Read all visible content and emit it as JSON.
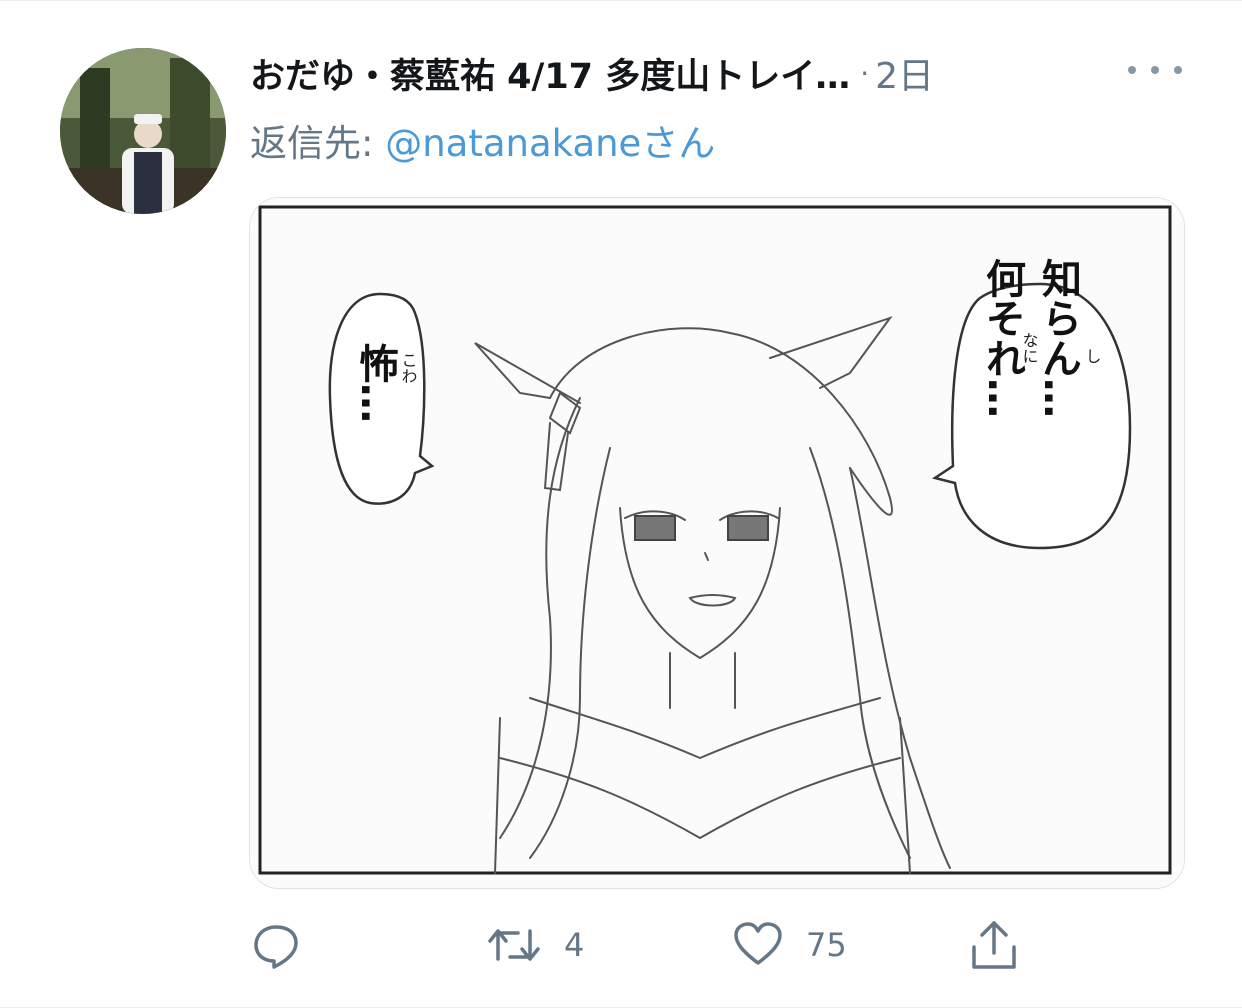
{
  "tweet": {
    "author": {
      "display_name": "おだゆ・蔡藍祐 4/17 多度山トレイ…",
      "avatar_icon": "profile-photo"
    },
    "separator": "·",
    "time": "2日",
    "more_icon": "more-dots-icon",
    "reply": {
      "prefix": "返信先: ",
      "handle": "@natanakane",
      "suffix": "さん"
    },
    "media": {
      "description_icon": "manga-panel",
      "bubble_left": {
        "text": "怖…",
        "ruby": "こわ"
      },
      "bubble_right": {
        "line1": "知らん…",
        "line1_ruby": "し",
        "line2": "何それ…",
        "line2_ruby": "なに"
      }
    },
    "actions": {
      "reply_icon": "reply-icon",
      "retweet_icon": "retweet-icon",
      "retweet_count": "4",
      "like_icon": "heart-icon",
      "like_count": "75",
      "share_icon": "share-icon"
    }
  },
  "colors": {
    "text_primary": "#14171a",
    "text_secondary": "#657786",
    "link": "#4a9ad8",
    "border": "#e6ecf0"
  }
}
